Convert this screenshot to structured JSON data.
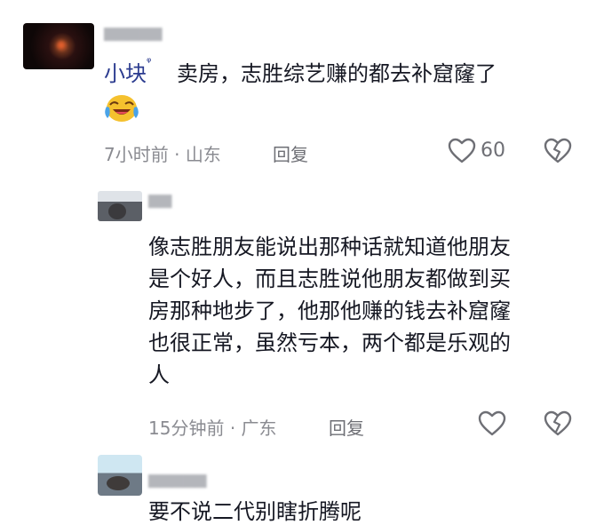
{
  "comments": [
    {
      "username": "小块",
      "username_badge": "ᵠ",
      "text": "卖房，志胜综艺赚的都去补窟窿了",
      "emoji_icon": "crying-laughing-emoji",
      "time": "7小时前",
      "separator": "·",
      "location": "山东",
      "reply_label": "回复",
      "like_count": "60"
    }
  ],
  "replies": [
    {
      "text_lines": [
        "像志胜朋友能说出那种话就知道他朋友",
        "是个好人，而且志胜说他朋友都做到买",
        "房那种地步了，他那他赚的钱去补窟窿",
        "也很正常，虽然亏本，两个都是乐观的",
        "人"
      ],
      "time": "15分钟前",
      "separator": "·",
      "location": "广东",
      "reply_label": "回复"
    },
    {
      "partial_text": "要不说二代别瞎折腾呢"
    }
  ],
  "colors": {
    "username": "#2b3b8f",
    "meta": "#8a8b91"
  }
}
